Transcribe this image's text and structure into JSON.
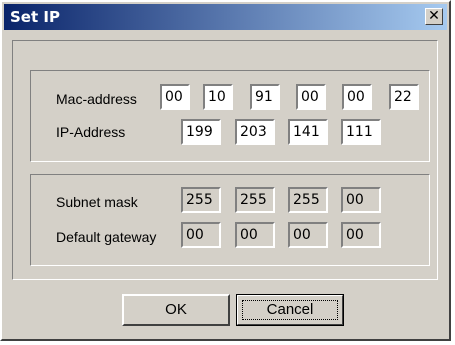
{
  "window": {
    "title": "Set IP",
    "close_glyph": "✕"
  },
  "labels": {
    "mac_address": "Mac-address",
    "ip_address": "IP-Address",
    "subnet_mask": "Subnet mask",
    "default_gateway": "Default gateway"
  },
  "mac": [
    "00",
    "10",
    "91",
    "00",
    "00",
    "22"
  ],
  "ip": [
    "199",
    "203",
    "141",
    "111"
  ],
  "subnet": [
    "255",
    "255",
    "255",
    "00"
  ],
  "gateway": [
    "00",
    "00",
    "00",
    "00"
  ],
  "buttons": {
    "ok": "OK",
    "cancel": "Cancel"
  }
}
